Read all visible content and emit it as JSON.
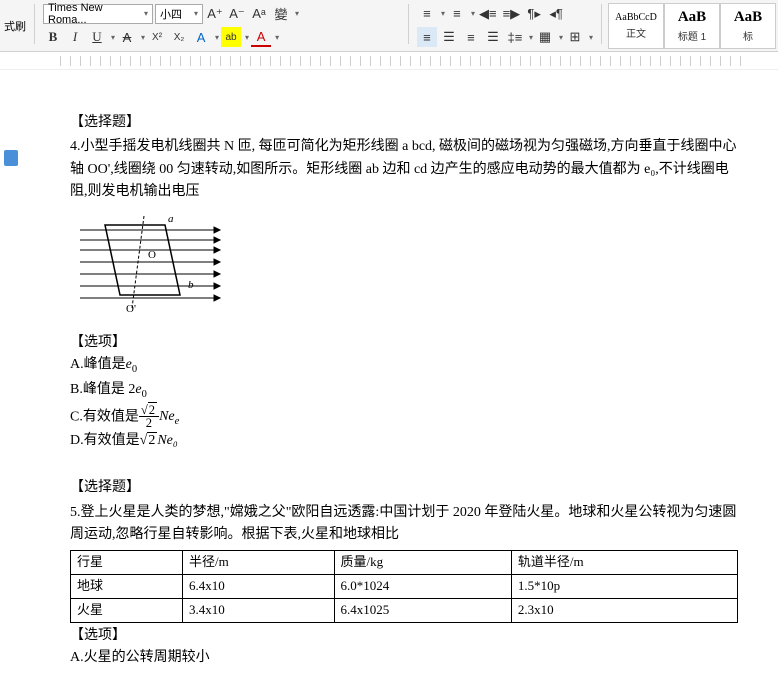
{
  "ribbon": {
    "format_brush": "式刷",
    "font_name": "Times New Roma...",
    "font_size": "小四",
    "grow": "A⁺",
    "shrink": "A⁻",
    "clear": "Aᵃ",
    "case": "變",
    "bold": "B",
    "italic": "I",
    "underline": "U",
    "strike": "A",
    "sup": "X²",
    "sub": "X₂",
    "fontfx": "A",
    "highlight": "ab",
    "fontcolor": "A"
  },
  "styles": {
    "s1_preview": "AaBbCcD",
    "s1_label": "正文",
    "s2_preview": "AaB",
    "s2_label": "标题 1",
    "s3_preview": "AaB",
    "s3_label": "标"
  },
  "q4": {
    "label": "【选择题】",
    "text": "4.小型手摇发电机线圈共 N 匝, 每匝可简化为矩形线圈 a bcd, 磁极间的磁场视为匀强磁场,方向垂直于线圈中心轴 OO',线圈绕 00 匀速转动,如图所示。矩形线圈 ab 边和 cd 边产生的感应电动势的最大值都为 e₀,不计线圈电阻,则发电机输出电压",
    "opts_label": "【选项】",
    "A_pre": "A.峰值是",
    "A_sym": "e₀",
    "B_pre": "B.峰值是 2",
    "B_sym": "e₀",
    "C_pre": "C.有效值是",
    "C_num": "√2",
    "C_den": "2",
    "C_suf": "Ne",
    "C_sub": "e",
    "D_pre": "D.有效值是",
    "D_rt": "2",
    "D_suf": "Ne₀"
  },
  "q5": {
    "label": "【选择题】",
    "text": "5.登上火星是人类的梦想,\"嫦娥之父\"欧阳自远透露:中国计划于 2020 年登陆火星。地球和火星公转视为匀速圆周运动,忽略行星自转影响。根据下表,火星和地球相比",
    "th1": "行星",
    "th2": "半径/m",
    "th3": "质量/kg",
    "th4": "轨道半径/m",
    "r1c1": "地球",
    "r1c2": "6.4x10",
    "r1c3": "6.0*1024",
    "r1c4": "1.5*10p",
    "r2c1": "火星",
    "r2c2": "3.4x10",
    "r2c3": "6.4x1025",
    "r2c4": "2.3x10",
    "opts_label": "【选项】",
    "A": "A.火星的公转周期较小"
  }
}
